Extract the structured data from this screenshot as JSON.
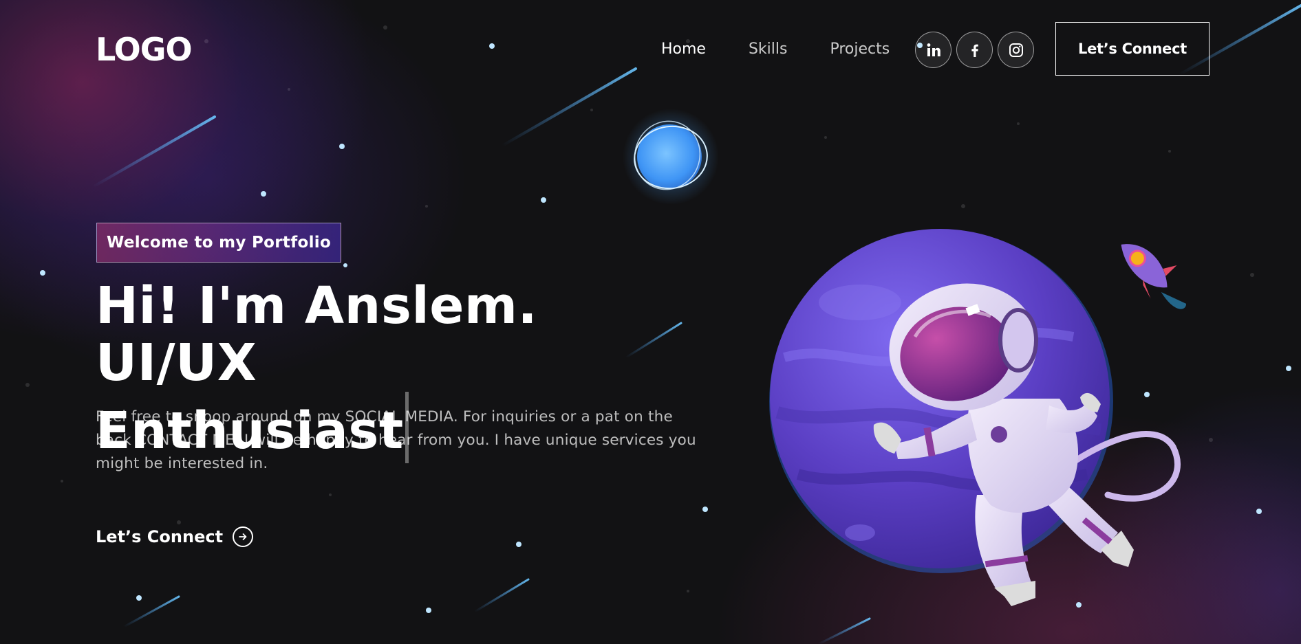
{
  "nav": {
    "logo": "LOGO",
    "links": [
      {
        "label": "Home",
        "active": true
      },
      {
        "label": "Skills",
        "active": false
      },
      {
        "label": "Projects",
        "active": false
      }
    ],
    "social_icons": [
      "linkedin-icon",
      "facebook-icon",
      "instagram-icon"
    ],
    "connect_label": "Let’s Connect"
  },
  "hero": {
    "tagline": "Welcome to my Portfolio",
    "headline_line1": "Hi! I'm Anslem. UI/UX",
    "headline_line2": "Enthusiast",
    "intro": "Feel free to snoop around on my SOCIAL MEDIA. For inquiries or a pat on the back CONTACT ME, I will be happy to hear from you. I have unique services you might be interested in.",
    "cta_label": "Let’s Connect",
    "cta_icon": "arrow-right-circle-icon"
  },
  "illustration": {
    "subject": "astronaut-planet-illustration"
  },
  "colors": {
    "background": "#121214",
    "tagline_gradient_start": "#aa367c",
    "tagline_gradient_end": "#4a2fbd",
    "planet": "#5b3fc4",
    "blue_planet": "#4fa8ff"
  }
}
